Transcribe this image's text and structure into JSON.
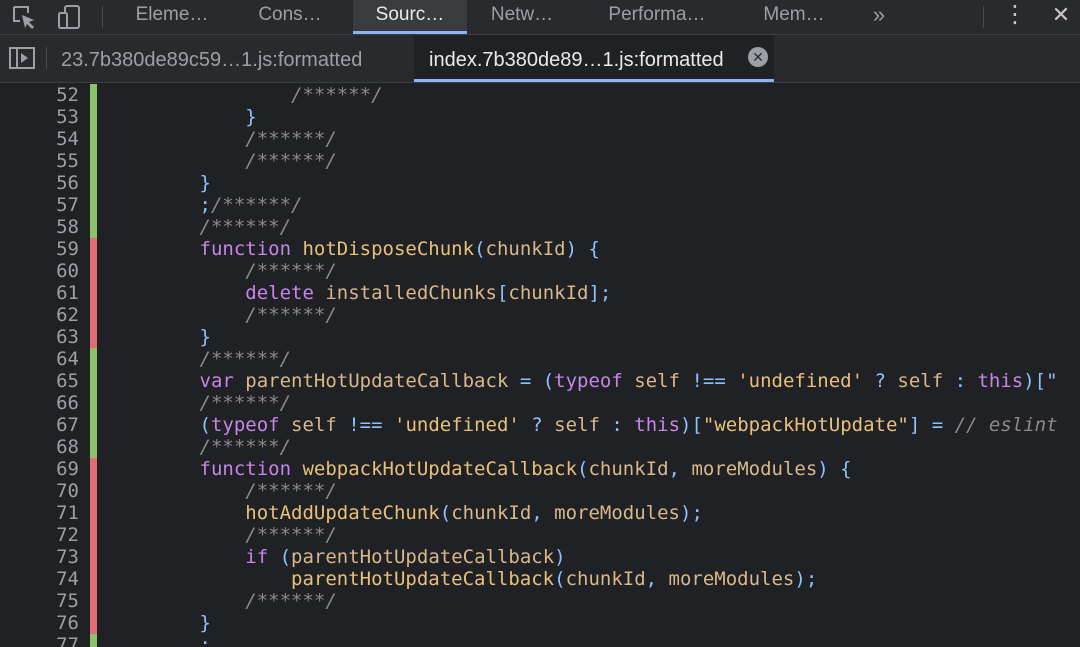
{
  "toolbar": {
    "icons": [
      "inspect-element-icon",
      "device-toggle-icon"
    ],
    "panels": [
      "Eleme…",
      "Cons…",
      "Sourc…",
      "Netw…",
      "Performa…",
      "Mem…"
    ],
    "active_panel": "Sourc…",
    "more_tabs_glyph": "»",
    "kebab_glyph": "⋮",
    "close_glyph": "✕"
  },
  "file_tabs": {
    "toggle_navigator_glyph": "▶",
    "tabs": [
      {
        "label": "23.7b380de89c59…1.js:formatted",
        "active": false
      },
      {
        "label": "index.7b380de89…1.js:formatted",
        "active": true
      }
    ],
    "close_glyph": "✕"
  },
  "colors": {
    "accent": "#8ab4f8",
    "gutter_added": "#8cc36a",
    "gutter_modified": "#e06c75",
    "comment": "#8a8a8a",
    "keyword": "#c586e8",
    "function_name": "#e8c07a",
    "variable": "#d7b88a",
    "punctuation": "#8cc3ff"
  },
  "code_lines": [
    {
      "n": "52",
      "m": "add",
      "t": [
        [
          "cmt",
          "                /******/"
        ]
      ]
    },
    {
      "n": "53",
      "m": "add",
      "t": [
        [
          "pun",
          "            }"
        ]
      ]
    },
    {
      "n": "54",
      "m": "add",
      "t": [
        [
          "cmt",
          "            /******/"
        ]
      ]
    },
    {
      "n": "55",
      "m": "add",
      "t": [
        [
          "cmt",
          "            /******/"
        ]
      ]
    },
    {
      "n": "56",
      "m": "add",
      "t": [
        [
          "pun",
          "        }"
        ]
      ]
    },
    {
      "n": "57",
      "m": "add",
      "t": [
        [
          "pun",
          "        ;"
        ],
        [
          "cmt",
          "/******/"
        ]
      ]
    },
    {
      "n": "58",
      "m": "add",
      "t": [
        [
          "cmt",
          "        /******/"
        ]
      ]
    },
    {
      "n": "59",
      "m": "mod",
      "t": [
        [
          "kw",
          "        function "
        ],
        [
          "fn",
          "hotDisposeChunk"
        ],
        [
          "pun",
          "("
        ],
        [
          "var",
          "chunkId"
        ],
        [
          "pun",
          ") {"
        ]
      ]
    },
    {
      "n": "60",
      "m": "mod",
      "t": [
        [
          "cmt",
          "            /******/"
        ]
      ]
    },
    {
      "n": "61",
      "m": "mod",
      "t": [
        [
          "kw",
          "            delete "
        ],
        [
          "var",
          "installedChunks"
        ],
        [
          "pun",
          "["
        ],
        [
          "var",
          "chunkId"
        ],
        [
          "pun",
          "];"
        ]
      ]
    },
    {
      "n": "62",
      "m": "mod",
      "t": [
        [
          "cmt",
          "            /******/"
        ]
      ]
    },
    {
      "n": "63",
      "m": "mod",
      "t": [
        [
          "pun",
          "        }"
        ]
      ]
    },
    {
      "n": "64",
      "m": "add",
      "t": [
        [
          "cmt",
          "        /******/"
        ]
      ]
    },
    {
      "n": "65",
      "m": "add",
      "t": [
        [
          "kw",
          "        var "
        ],
        [
          "var",
          "parentHotUpdateCallback"
        ],
        [
          "pun",
          " = ("
        ],
        [
          "kw",
          "typeof "
        ],
        [
          "var",
          "self"
        ],
        [
          "pun",
          " !== "
        ],
        [
          "str",
          "'undefined'"
        ],
        [
          "pun",
          " ? "
        ],
        [
          "var",
          "self"
        ],
        [
          "pun",
          " : "
        ],
        [
          "kw",
          "this"
        ],
        [
          "pun",
          ")[\""
        ]
      ]
    },
    {
      "n": "66",
      "m": "add",
      "t": [
        [
          "cmt",
          "        /******/"
        ]
      ]
    },
    {
      "n": "67",
      "m": "add",
      "t": [
        [
          "pun",
          "        ("
        ],
        [
          "kw",
          "typeof "
        ],
        [
          "var",
          "self"
        ],
        [
          "pun",
          " !== "
        ],
        [
          "str",
          "'undefined'"
        ],
        [
          "pun",
          " ? "
        ],
        [
          "var",
          "self"
        ],
        [
          "pun",
          " : "
        ],
        [
          "kw",
          "this"
        ],
        [
          "pun",
          ")["
        ],
        [
          "str",
          "\"webpackHotUpdate\""
        ],
        [
          "pun",
          "] = "
        ],
        [
          "cmt",
          "// eslint"
        ]
      ]
    },
    {
      "n": "68",
      "m": "add",
      "t": [
        [
          "cmt",
          "        /******/"
        ]
      ]
    },
    {
      "n": "69",
      "m": "mod",
      "t": [
        [
          "kw",
          "        function "
        ],
        [
          "fn",
          "webpackHotUpdateCallback"
        ],
        [
          "pun",
          "("
        ],
        [
          "var",
          "chunkId"
        ],
        [
          "pun",
          ", "
        ],
        [
          "var",
          "moreModules"
        ],
        [
          "pun",
          ") {"
        ]
      ]
    },
    {
      "n": "70",
      "m": "mod",
      "t": [
        [
          "cmt",
          "            /******/"
        ]
      ]
    },
    {
      "n": "71",
      "m": "mod",
      "t": [
        [
          "fn",
          "            hotAddUpdateChunk"
        ],
        [
          "pun",
          "("
        ],
        [
          "var",
          "chunkId"
        ],
        [
          "pun",
          ", "
        ],
        [
          "var",
          "moreModules"
        ],
        [
          "pun",
          ");"
        ]
      ]
    },
    {
      "n": "72",
      "m": "mod",
      "t": [
        [
          "cmt",
          "            /******/"
        ]
      ]
    },
    {
      "n": "73",
      "m": "mod",
      "t": [
        [
          "kw",
          "            if "
        ],
        [
          "pun",
          "("
        ],
        [
          "var",
          "parentHotUpdateCallback"
        ],
        [
          "pun",
          ")"
        ]
      ]
    },
    {
      "n": "74",
      "m": "mod",
      "t": [
        [
          "fn",
          "                parentHotUpdateCallback"
        ],
        [
          "pun",
          "("
        ],
        [
          "var",
          "chunkId"
        ],
        [
          "pun",
          ", "
        ],
        [
          "var",
          "moreModules"
        ],
        [
          "pun",
          ");"
        ]
      ]
    },
    {
      "n": "75",
      "m": "mod",
      "t": [
        [
          "cmt",
          "            /******/"
        ]
      ]
    },
    {
      "n": "76",
      "m": "mod",
      "t": [
        [
          "pun",
          "        }"
        ]
      ]
    },
    {
      "n": "77",
      "m": "add",
      "t": [
        [
          "pun",
          "        ;"
        ]
      ]
    }
  ]
}
